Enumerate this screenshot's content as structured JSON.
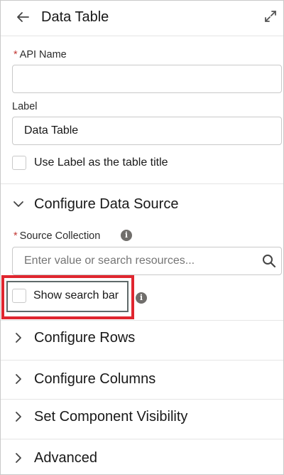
{
  "header": {
    "title": "Data Table",
    "back_icon": "arrow-left-icon",
    "expand_icon": "expand-icon"
  },
  "form": {
    "api_name": {
      "required_marker": "*",
      "label": "API Name",
      "value": ""
    },
    "label": {
      "label": "Label",
      "value": "Data Table"
    },
    "use_label_as_title": {
      "label": "Use Label as the table title",
      "checked": false
    }
  },
  "sections": {
    "configure_data_source": {
      "title": "Configure Data Source",
      "expanded": true,
      "source_collection": {
        "required_marker": "*",
        "label": "Source Collection",
        "info_glyph": "i",
        "placeholder": "Enter value or search resources..."
      },
      "show_search_bar": {
        "label": "Show search bar",
        "checked": false,
        "info_glyph": "i"
      }
    },
    "configure_rows": {
      "title": "Configure Rows",
      "expanded": false
    },
    "configure_columns": {
      "title": "Configure Columns",
      "expanded": false
    },
    "set_component_visibility": {
      "title": "Set Component Visibility",
      "expanded": false
    },
    "advanced": {
      "title": "Advanced",
      "expanded": false
    }
  },
  "colors": {
    "required": "#c23934",
    "highlight": "#e0262f",
    "border": "#c9c9c9",
    "info_icon": "#706e6b"
  }
}
